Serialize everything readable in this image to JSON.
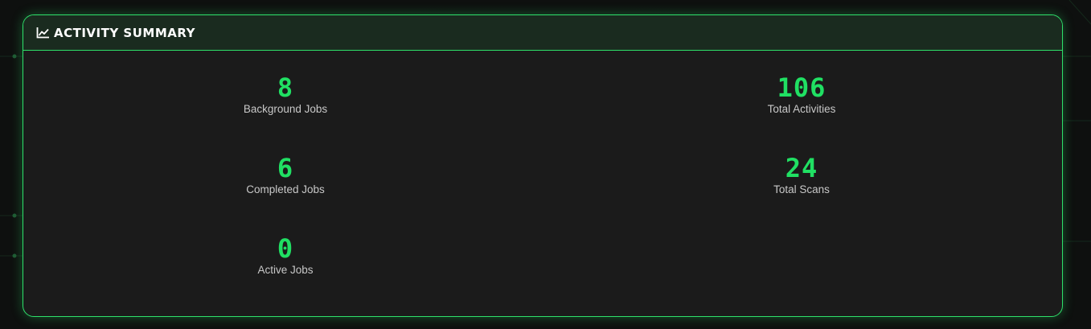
{
  "header": {
    "title": "ACTIVITY SUMMARY",
    "icon": "line-chart-icon"
  },
  "stats": [
    {
      "value": "8",
      "label": "Background Jobs"
    },
    {
      "value": "106",
      "label": "Total Activities"
    },
    {
      "value": "6",
      "label": "Completed Jobs"
    },
    {
      "value": "24",
      "label": "Total Scans"
    },
    {
      "value": "0",
      "label": "Active Jobs"
    }
  ],
  "colors": {
    "accent": "#20e063",
    "card_bg": "#1b1b1b",
    "header_bg": "#1a2b1f",
    "label": "#c8c8c8"
  }
}
